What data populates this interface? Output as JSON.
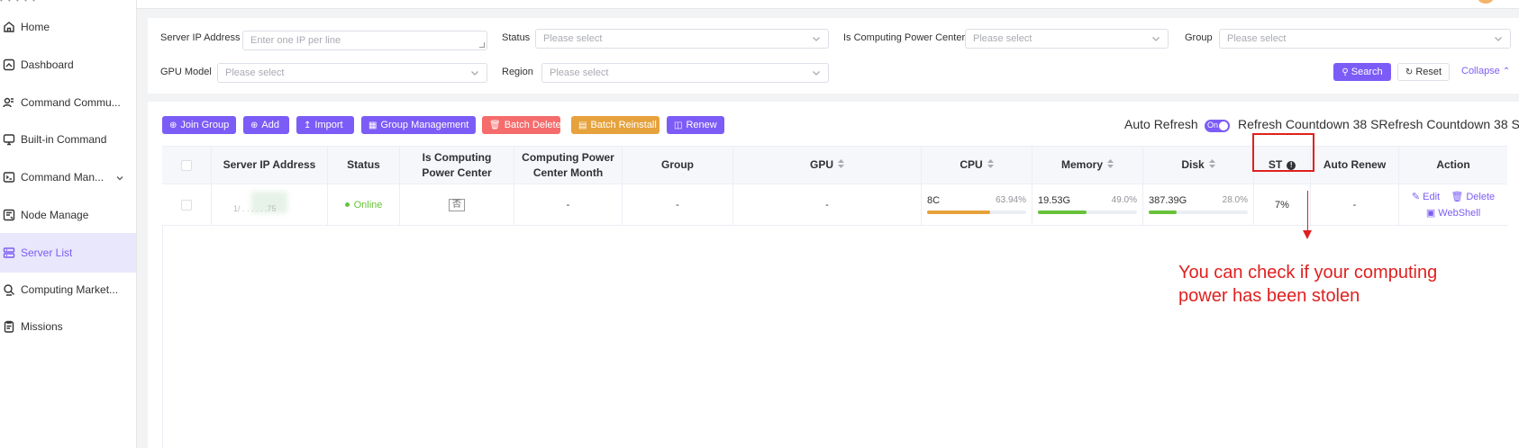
{
  "sidebar": {
    "logo": "• • • • •",
    "items": [
      {
        "label": "Home",
        "icon": "home-icon"
      },
      {
        "label": "Dashboard",
        "icon": "dashboard-icon"
      },
      {
        "label": "Command Commu...",
        "icon": "command-community-icon"
      },
      {
        "label": "Built-in Command",
        "icon": "monitor-icon"
      },
      {
        "label": "Command Man...",
        "icon": "command-manage-icon"
      },
      {
        "label": "Node Manage",
        "icon": "node-icon"
      },
      {
        "label": "Server List",
        "icon": "server-icon"
      },
      {
        "label": "Computing Market...",
        "icon": "market-icon"
      },
      {
        "label": "Missions",
        "icon": "missions-icon"
      }
    ]
  },
  "filters": {
    "server_ip_label": "Server IP Address",
    "server_ip_placeholder": "Enter one IP per line",
    "status_label": "Status",
    "status_placeholder": "Please select",
    "ipc_label": "Is Computing Power Center",
    "ipc_placeholder": "Please select",
    "group_label": "Group",
    "group_placeholder": "Please select",
    "gpu_label": "GPU Model",
    "gpu_placeholder": "Please select",
    "region_label": "Region",
    "region_placeholder": "Please select",
    "search": "Search",
    "reset": "Reset",
    "collapse": "Collapse"
  },
  "toolbar": {
    "join_group": "Join Group",
    "add": "Add",
    "import": "Import",
    "group_management": "Group Management",
    "batch_delete": "Batch Delete",
    "batch_reinstall": "Batch Reinstall",
    "renew": "Renew",
    "auto_refresh": "Auto Refresh",
    "toggle": "On",
    "countdown": "Refresh Countdown 38 SRefresh Countdown 38 S"
  },
  "table": {
    "headers": {
      "ip": "Server IP Address",
      "status": "Status",
      "ipc_line1": "Is Computing",
      "ipc_line2": "Power Center",
      "month_line1": "Computing Power",
      "month_line2": "Center Month",
      "group": "Group",
      "gpu": "GPU",
      "cpu": "CPU",
      "memory": "Memory",
      "disk": "Disk",
      "st": "ST",
      "auto_renew": "Auto Renew",
      "action": "Action"
    },
    "row": {
      "ip_fragment": "1/ . . . . . .75",
      "status": "Online",
      "ipc": "否",
      "month": "-",
      "group": "-",
      "gpu": "-",
      "cpu_value": "8C",
      "cpu_pct": "63.94%",
      "cpu_fill": 0.6394,
      "mem_value": "19.53G",
      "mem_pct": "49.0%",
      "mem_fill": 0.49,
      "disk_value": "387.39G",
      "disk_pct": "28.0%",
      "disk_fill": 0.28,
      "st": "7%",
      "auto_renew": "-",
      "edit": "Edit",
      "delete": "Delete",
      "webshell": "WebShell"
    }
  },
  "colors": {
    "accent": "#7c5cf6",
    "cpu_bar": "#e6a23c",
    "mem_bar": "#67c23a",
    "disk_bar": "#67c23a",
    "annotation": "#e02020"
  },
  "annotation": {
    "text": "You can check if your computing power has been stolen"
  }
}
